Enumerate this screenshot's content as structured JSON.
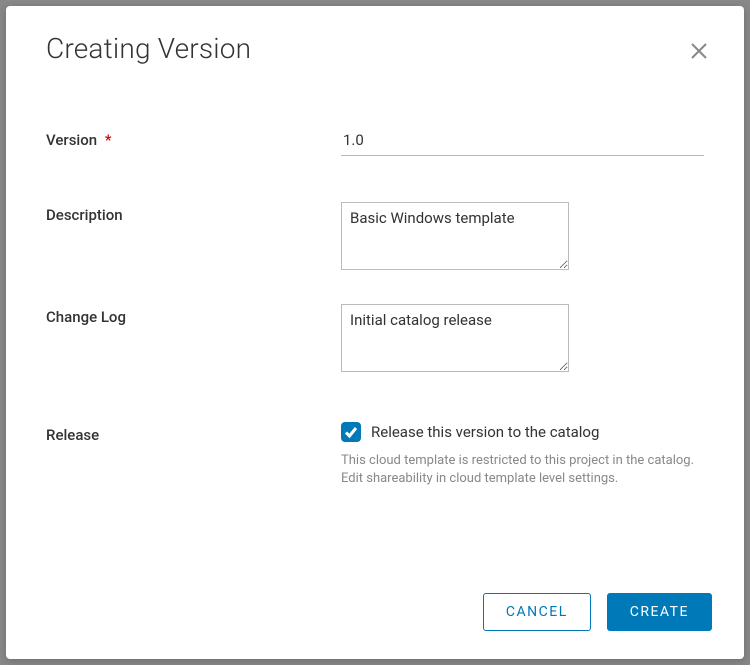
{
  "modal": {
    "title": "Creating Version",
    "fields": {
      "version": {
        "label": "Version",
        "value": "1.0",
        "required_marker": "*"
      },
      "description": {
        "label": "Description",
        "value": "Basic Windows template"
      },
      "changelog": {
        "label": "Change Log",
        "value": "Initial catalog release"
      },
      "release": {
        "label": "Release",
        "checkbox_label": "Release this version to the catalog",
        "helper": "This cloud template is restricted to this project in the catalog. Edit shareability in cloud template level settings."
      }
    },
    "footer": {
      "cancel": "CANCEL",
      "create": "CREATE"
    }
  }
}
